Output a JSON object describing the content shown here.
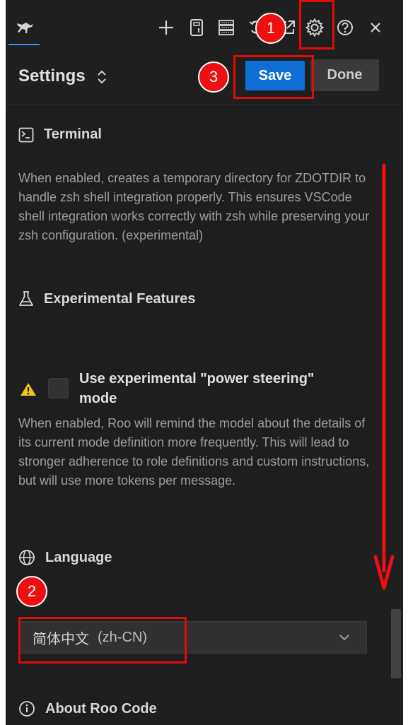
{
  "header": {
    "title": "Settings",
    "save_label": "Save",
    "done_label": "Done"
  },
  "toolbar": {
    "icons": [
      "kangaroo-logo-icon",
      "plus-icon",
      "history-icon",
      "server-icon",
      "refresh-icon",
      "popout-icon",
      "gear-icon",
      "help-icon",
      "close-icon"
    ]
  },
  "sections": {
    "terminal": {
      "title": "Terminal",
      "description": "When enabled, creates a temporary directory for ZDOTDIR to handle zsh shell integration properly. This ensures VSCode shell integration works correctly with zsh while preserving your zsh configuration. (experimental)"
    },
    "experimental": {
      "title": "Experimental Features",
      "checkbox_label": "Use experimental \"power steering\" mode",
      "checkbox_checked": false,
      "description": "When enabled, Roo will remind the model about the details of its current mode definition more frequently. This will lead to stronger adherence to role definitions and custom instructions, but will use more tokens per message."
    },
    "language": {
      "title": "Language",
      "selected_name": "简体中文",
      "selected_code": "(zh-CN)"
    },
    "about": {
      "title": "About Roo Code"
    }
  },
  "annotations": {
    "step1": "1",
    "step2": "2",
    "step3": "3",
    "color": "#e00b0b"
  }
}
